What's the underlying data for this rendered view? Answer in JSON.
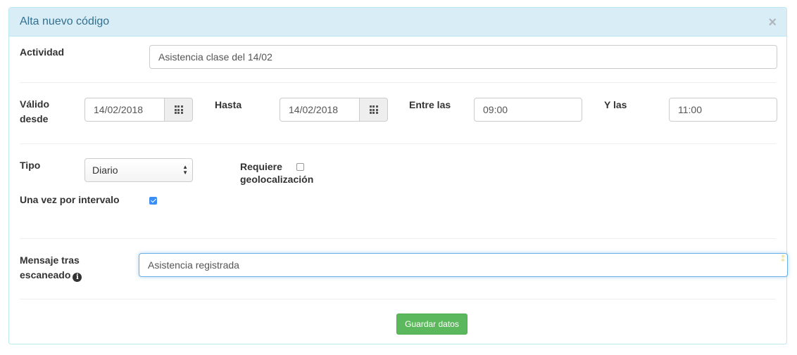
{
  "panel": {
    "title": "Alta nuevo código",
    "close_label": "×"
  },
  "form": {
    "actividad": {
      "label": "Actividad",
      "value": "Asistencia clase del 14/02"
    },
    "valido_desde": {
      "label_line1": "Válido",
      "label_line2": "desde",
      "value": "14/02/2018",
      "icon": "calendar-grid-icon"
    },
    "hasta": {
      "label": "Hasta",
      "value": "14/02/2018",
      "icon": "calendar-grid-icon"
    },
    "entre_las": {
      "label": "Entre las",
      "value": "09:00"
    },
    "y_las": {
      "label": "Y las",
      "value": "11:00"
    },
    "tipo": {
      "label": "Tipo",
      "value": "Diario",
      "arrows": "▲▼"
    },
    "requiere_geo": {
      "label_line1": "Requiere",
      "label_line2": "geolocalización",
      "checked": false
    },
    "una_vez": {
      "label": "Una vez por intervalo",
      "checked": true
    },
    "mensaje": {
      "label_line1": "Mensaje tras",
      "label_line2": "escaneado",
      "info_icon": "i",
      "value": "Asistencia registrada"
    }
  },
  "actions": {
    "save_label": "Guardar datos"
  },
  "colors": {
    "heading_bg": "#d9edf7",
    "heading_text": "#31708f",
    "save_button": "#5cb85c",
    "checkbox_checked": "#3b8ef5"
  }
}
